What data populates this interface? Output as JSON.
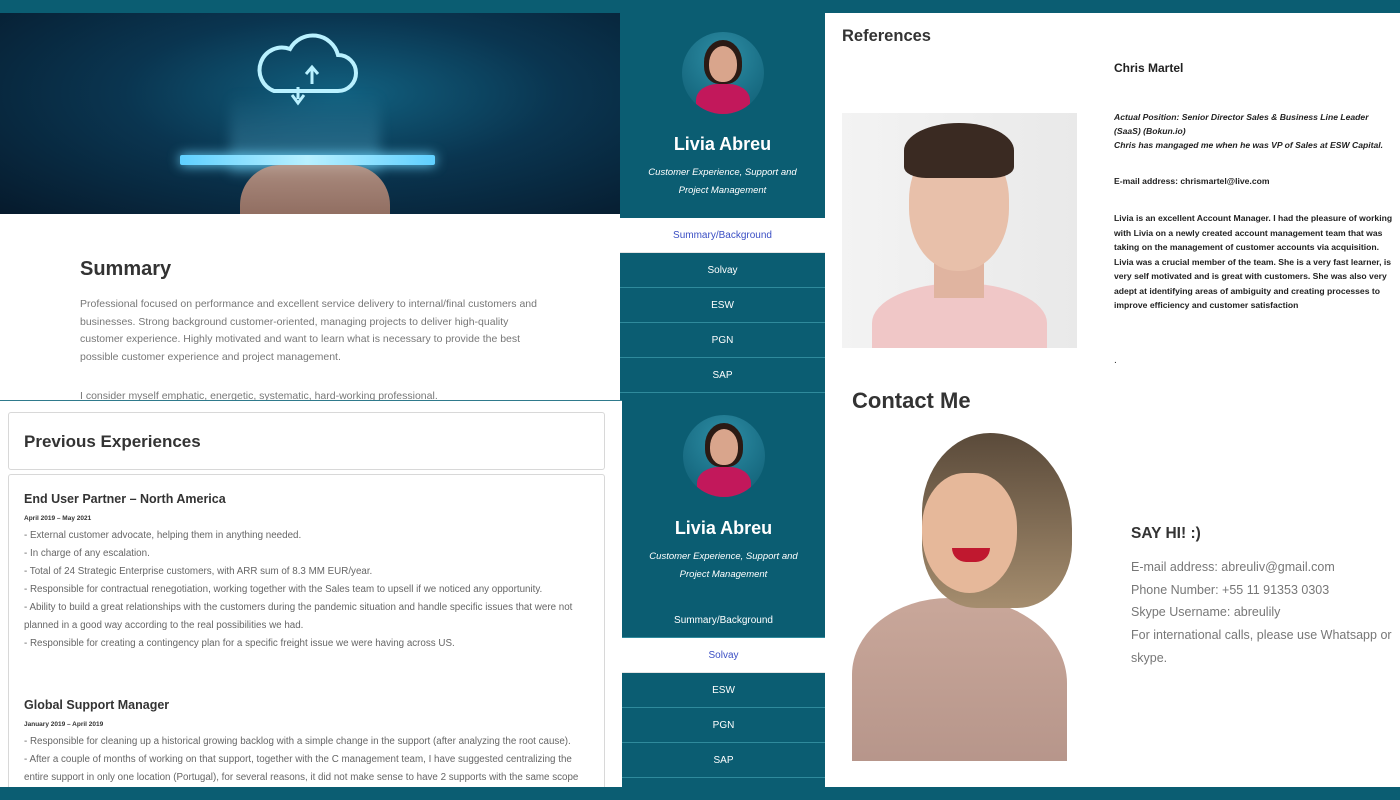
{
  "summary": {
    "title": "Summary",
    "paragraph": "Professional focused on performance and excellent service delivery to internal/final customers and businesses. Strong background customer-oriented, managing projects to deliver high-quality customer experience. Highly motivated and want to learn what is necessary to provide the best possible customer experience and project management.",
    "paragraph2": "I consider myself emphatic, energetic, systematic, hard-working professional."
  },
  "profile": {
    "name": "Livia Abreu",
    "role": "Customer Experience, Support and Project Management"
  },
  "nav_top": {
    "items": [
      "Summary/Background",
      "Solvay",
      "ESW",
      "PGN",
      "SAP"
    ],
    "active": "Summary/Background"
  },
  "nav_bottom": {
    "items": [
      "Summary/Background",
      "Solvay",
      "ESW",
      "PGN",
      "SAP"
    ],
    "active": "Solvay"
  },
  "experiences": {
    "title": "Previous Experiences",
    "jobs": [
      {
        "title": "End User Partner – North America",
        "date": "April 2019 – May 2021",
        "lines": [
          "- External customer advocate, helping them in anything needed.",
          "- In charge of any escalation.",
          "- Total of 24 Strategic Enterprise customers, with ARR sum of 8.3 MM EUR/year.",
          "- Responsible for contractual renegotiation, working together with the Sales team to upsell if we noticed any opportunity.",
          "- Ability to build a great relationships with the customers during the pandemic situation and handle specific issues that were not",
          "planned in a good way according to the real possibilities we had.",
          "- Responsible for creating a contingency plan for a specific freight issue we were having across US."
        ]
      },
      {
        "title": "Global Support Manager",
        "date": "January 2019 – April 2019",
        "lines": [
          "- Responsible for cleaning up a historical growing backlog with a simple change in the support (after analyzing the root cause).",
          "- After a couple of months of working on that support, together with the C management team, I have suggested centralizing the",
          "entire support in only one location (Portugal), for several reasons, it did not make sense to have 2 supports with the same scope"
        ]
      }
    ]
  },
  "references": {
    "title": "References",
    "name": "Chris Martel",
    "position": "Actual Position: Senior Director Sales & Business Line Leader (SaaS) (Bokun.io)",
    "relation": "Chris has mangaged me when he was VP of Sales at ESW Capital.",
    "email": "E-mail address: chrismartel@live.com",
    "quote": "Livia is an excellent Account Manager. I had the pleasure of working with Livia on a newly created account management team that was taking on the management of customer accounts via acquisition. Livia was a crucial member of the team. She is a very fast learner, is very self motivated and is great with customers. She was also very adept at identifying areas of ambiguity and creating processes to improve efficiency and customer satisfaction",
    "dot": "."
  },
  "contact": {
    "title": "Contact Me",
    "greeting": "SAY HI! :)",
    "email": "E-mail address: abreuliv@gmail.com",
    "phone": "Phone Number: +55 11 91353 0303",
    "skype": "Skype Username: abreulily",
    "note": "For international calls, please use Whatsapp or skype."
  },
  "colors": {
    "brand_teal": "#0b5d72",
    "active_link": "#3b4fc4",
    "lipstick": "#c0182f"
  },
  "icons": [
    "cloud-sync-icon"
  ]
}
